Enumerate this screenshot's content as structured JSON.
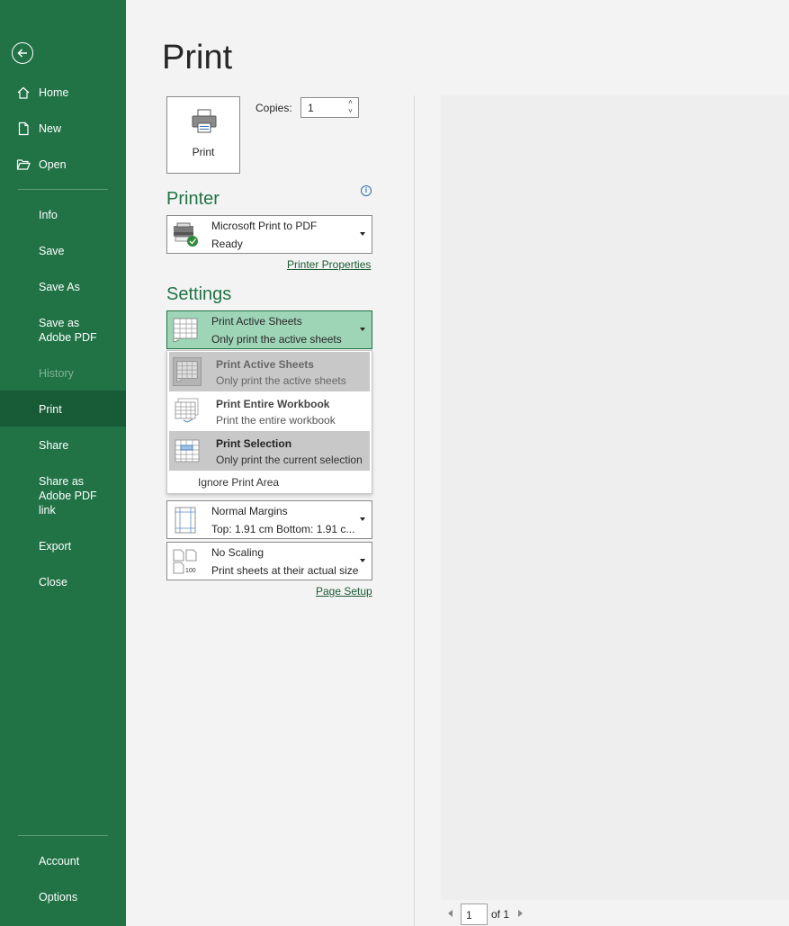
{
  "sidebar": {
    "top_items": [
      {
        "label": "Home",
        "icon": "home-icon"
      },
      {
        "label": "New",
        "icon": "new-document-icon"
      },
      {
        "label": "Open",
        "icon": "open-folder-icon"
      }
    ],
    "items": [
      {
        "label": "Info"
      },
      {
        "label": "Save"
      },
      {
        "label": "Save As"
      },
      {
        "label": "Save as Adobe PDF"
      },
      {
        "label": "History",
        "disabled": true
      },
      {
        "label": "Print",
        "selected": true
      },
      {
        "label": "Share"
      },
      {
        "label": "Share as Adobe PDF link"
      },
      {
        "label": "Export"
      },
      {
        "label": "Close"
      }
    ],
    "bottom_items": [
      {
        "label": "Account"
      },
      {
        "label": "Options"
      }
    ],
    "accent_color": "#217346",
    "selected_color": "#185c37"
  },
  "main": {
    "title": "Print",
    "print_button_label": "Print",
    "copies_label": "Copies:",
    "copies_value": "1",
    "printer": {
      "section_title": "Printer",
      "name": "Microsoft Print to PDF",
      "status": "Ready",
      "properties_link": "Printer Properties"
    },
    "settings": {
      "section_title": "Settings",
      "what_to_print": {
        "title": "Print Active Sheets",
        "subtitle": "Only print the active sheets"
      },
      "popup_options": [
        {
          "title": "Print Active Sheets",
          "subtitle": "Only print the active sheets"
        },
        {
          "title": "Print Entire Workbook",
          "subtitle": "Print the entire workbook"
        },
        {
          "title": "Print Selection",
          "subtitle": "Only print the current selection"
        }
      ],
      "ignore_print_area": "Ignore Print Area",
      "margins": {
        "title": "Normal Margins",
        "subtitle": "Top: 1.91 cm Bottom: 1.91 c..."
      },
      "scaling": {
        "title": "No Scaling",
        "subtitle": "Print sheets at their actual size"
      },
      "page_setup_link": "Page Setup"
    }
  },
  "preview": {
    "page_number": "1",
    "page_of": "of 1"
  }
}
